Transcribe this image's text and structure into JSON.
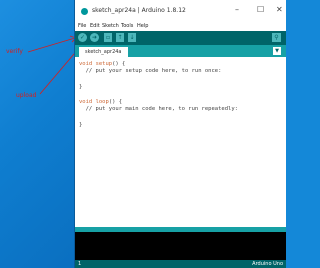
{
  "annotations": {
    "verify": "verify",
    "upload": "upload"
  },
  "window": {
    "title": "sketch_apr24a | Arduino 1.8.12",
    "controls": {
      "minimize": "–",
      "maximize": "☐",
      "close": "✕"
    }
  },
  "menu": [
    "File",
    "Edit",
    "Sketch",
    "Tools",
    "Help"
  ],
  "toolbar": {
    "verify_icon": "check-icon",
    "upload_icon": "arrow-right-icon",
    "new_icon": "new-file-icon",
    "open_icon": "open-arrow-icon",
    "save_icon": "save-arrow-icon",
    "serial_icon": "magnifier-icon"
  },
  "tab": {
    "label": "sketch_apr24a"
  },
  "code": {
    "line1_kw": "void",
    "line1_fn": "setup",
    "line1_rest": "() {",
    "line2": "  // put your setup code here, to run once:",
    "line4": "}",
    "line6_kw": "void",
    "line6_fn": "loop",
    "line6_rest": "() {",
    "line7": "  // put your main code here, to run repeatedly:",
    "line9": "}"
  },
  "status": {
    "line": "1",
    "board": "Arduino Uno"
  },
  "colors": {
    "toolbar": "#006468",
    "tabbar": "#17a1a5",
    "button": "#4db7bb",
    "annotation": "#d22020"
  }
}
